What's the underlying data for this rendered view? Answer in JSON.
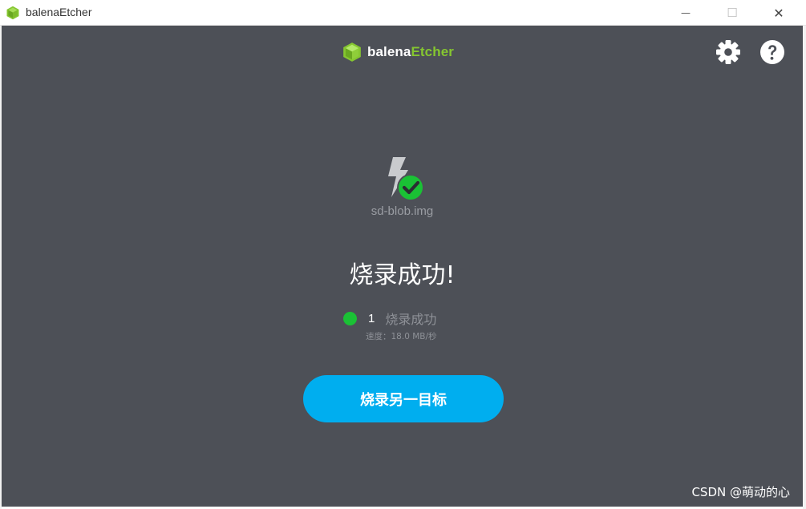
{
  "window": {
    "title": "balenaEtcher",
    "minimize_glyph": "—",
    "maximize_glyph": "☐",
    "close_glyph": "✕"
  },
  "header": {
    "logo_word1": "balena",
    "logo_word2": "Etcher",
    "settings_icon": "gear-icon",
    "help_icon": "question-icon"
  },
  "image": {
    "name": "sd-blob.img"
  },
  "status": {
    "headline": "烧录成功!",
    "success_count": "1",
    "success_label": "烧录成功",
    "speed": "速度：18.0 MB/秒"
  },
  "actions": {
    "flash_another": "烧录另一目标"
  },
  "watermark": "CSDN @萌动的心",
  "colors": {
    "background": "#4d5057",
    "accent": "#00aeef",
    "success": "#1ac135",
    "brand_green": "#85c630"
  }
}
